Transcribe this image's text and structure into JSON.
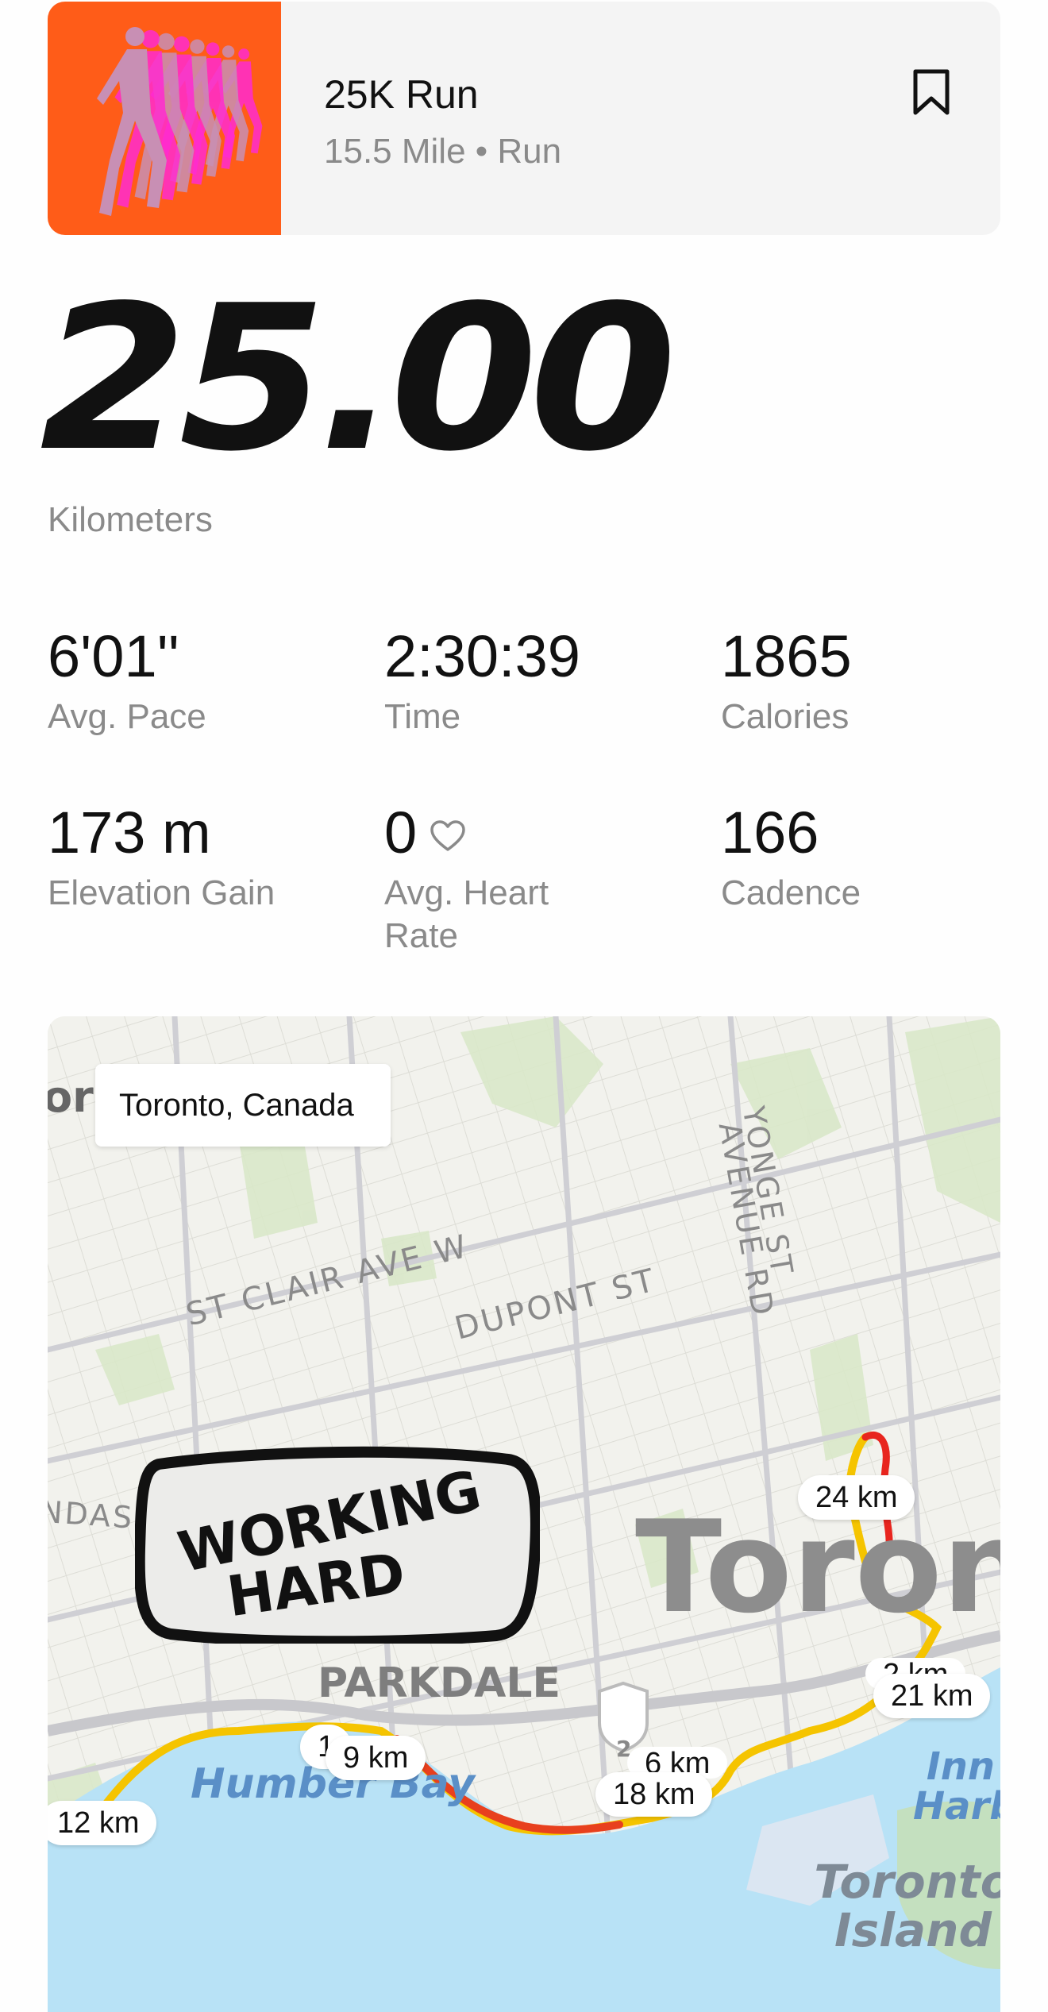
{
  "activity": {
    "title": "25K Run",
    "subtitle": "15.5 Mile • Run",
    "thumbnail_icon": "runner-sequence-icon",
    "bookmark_icon": "bookmark-icon"
  },
  "distance": {
    "value": "25.00",
    "unit": "Kilometers"
  },
  "stats": [
    {
      "value": "6'01''",
      "label": "Avg. Pace"
    },
    {
      "value": "2:30:39",
      "label": "Time"
    },
    {
      "value": "1865",
      "label": "Calories"
    },
    {
      "value": "173 m",
      "label": "Elevation Gain"
    },
    {
      "value": "0",
      "label": "Avg. Heart Rate",
      "icon": "heart-outline-icon"
    },
    {
      "value": "166",
      "label": "Cadence"
    }
  ],
  "map": {
    "location": "Toronto, Canada",
    "location_edge_text": "or",
    "sticker_text": [
      "WORKING",
      "HARD"
    ],
    "streets": [
      "ST CLAIR AVE W",
      "DUPONT ST",
      "NDAS ST W",
      "YONGE ST",
      "AVENUE RD"
    ],
    "neighborhood": "PARKDALE",
    "city": "Toron",
    "water": {
      "humber_bay": "Humber Bay",
      "inner_harbour": "Inn Harb",
      "toronto_island": "Toronto Island"
    },
    "highway_number": "2",
    "km_markers": [
      "24 km",
      "2 km",
      "21 km",
      "1",
      "9 km",
      "6 km",
      "18 km",
      "12 km"
    ],
    "colors": {
      "route_fast": "#f5c400",
      "route_slow": "#e8251e",
      "water": "#b6e1f5",
      "park": "#d8e8c8",
      "accent": "#ff5c18"
    }
  }
}
